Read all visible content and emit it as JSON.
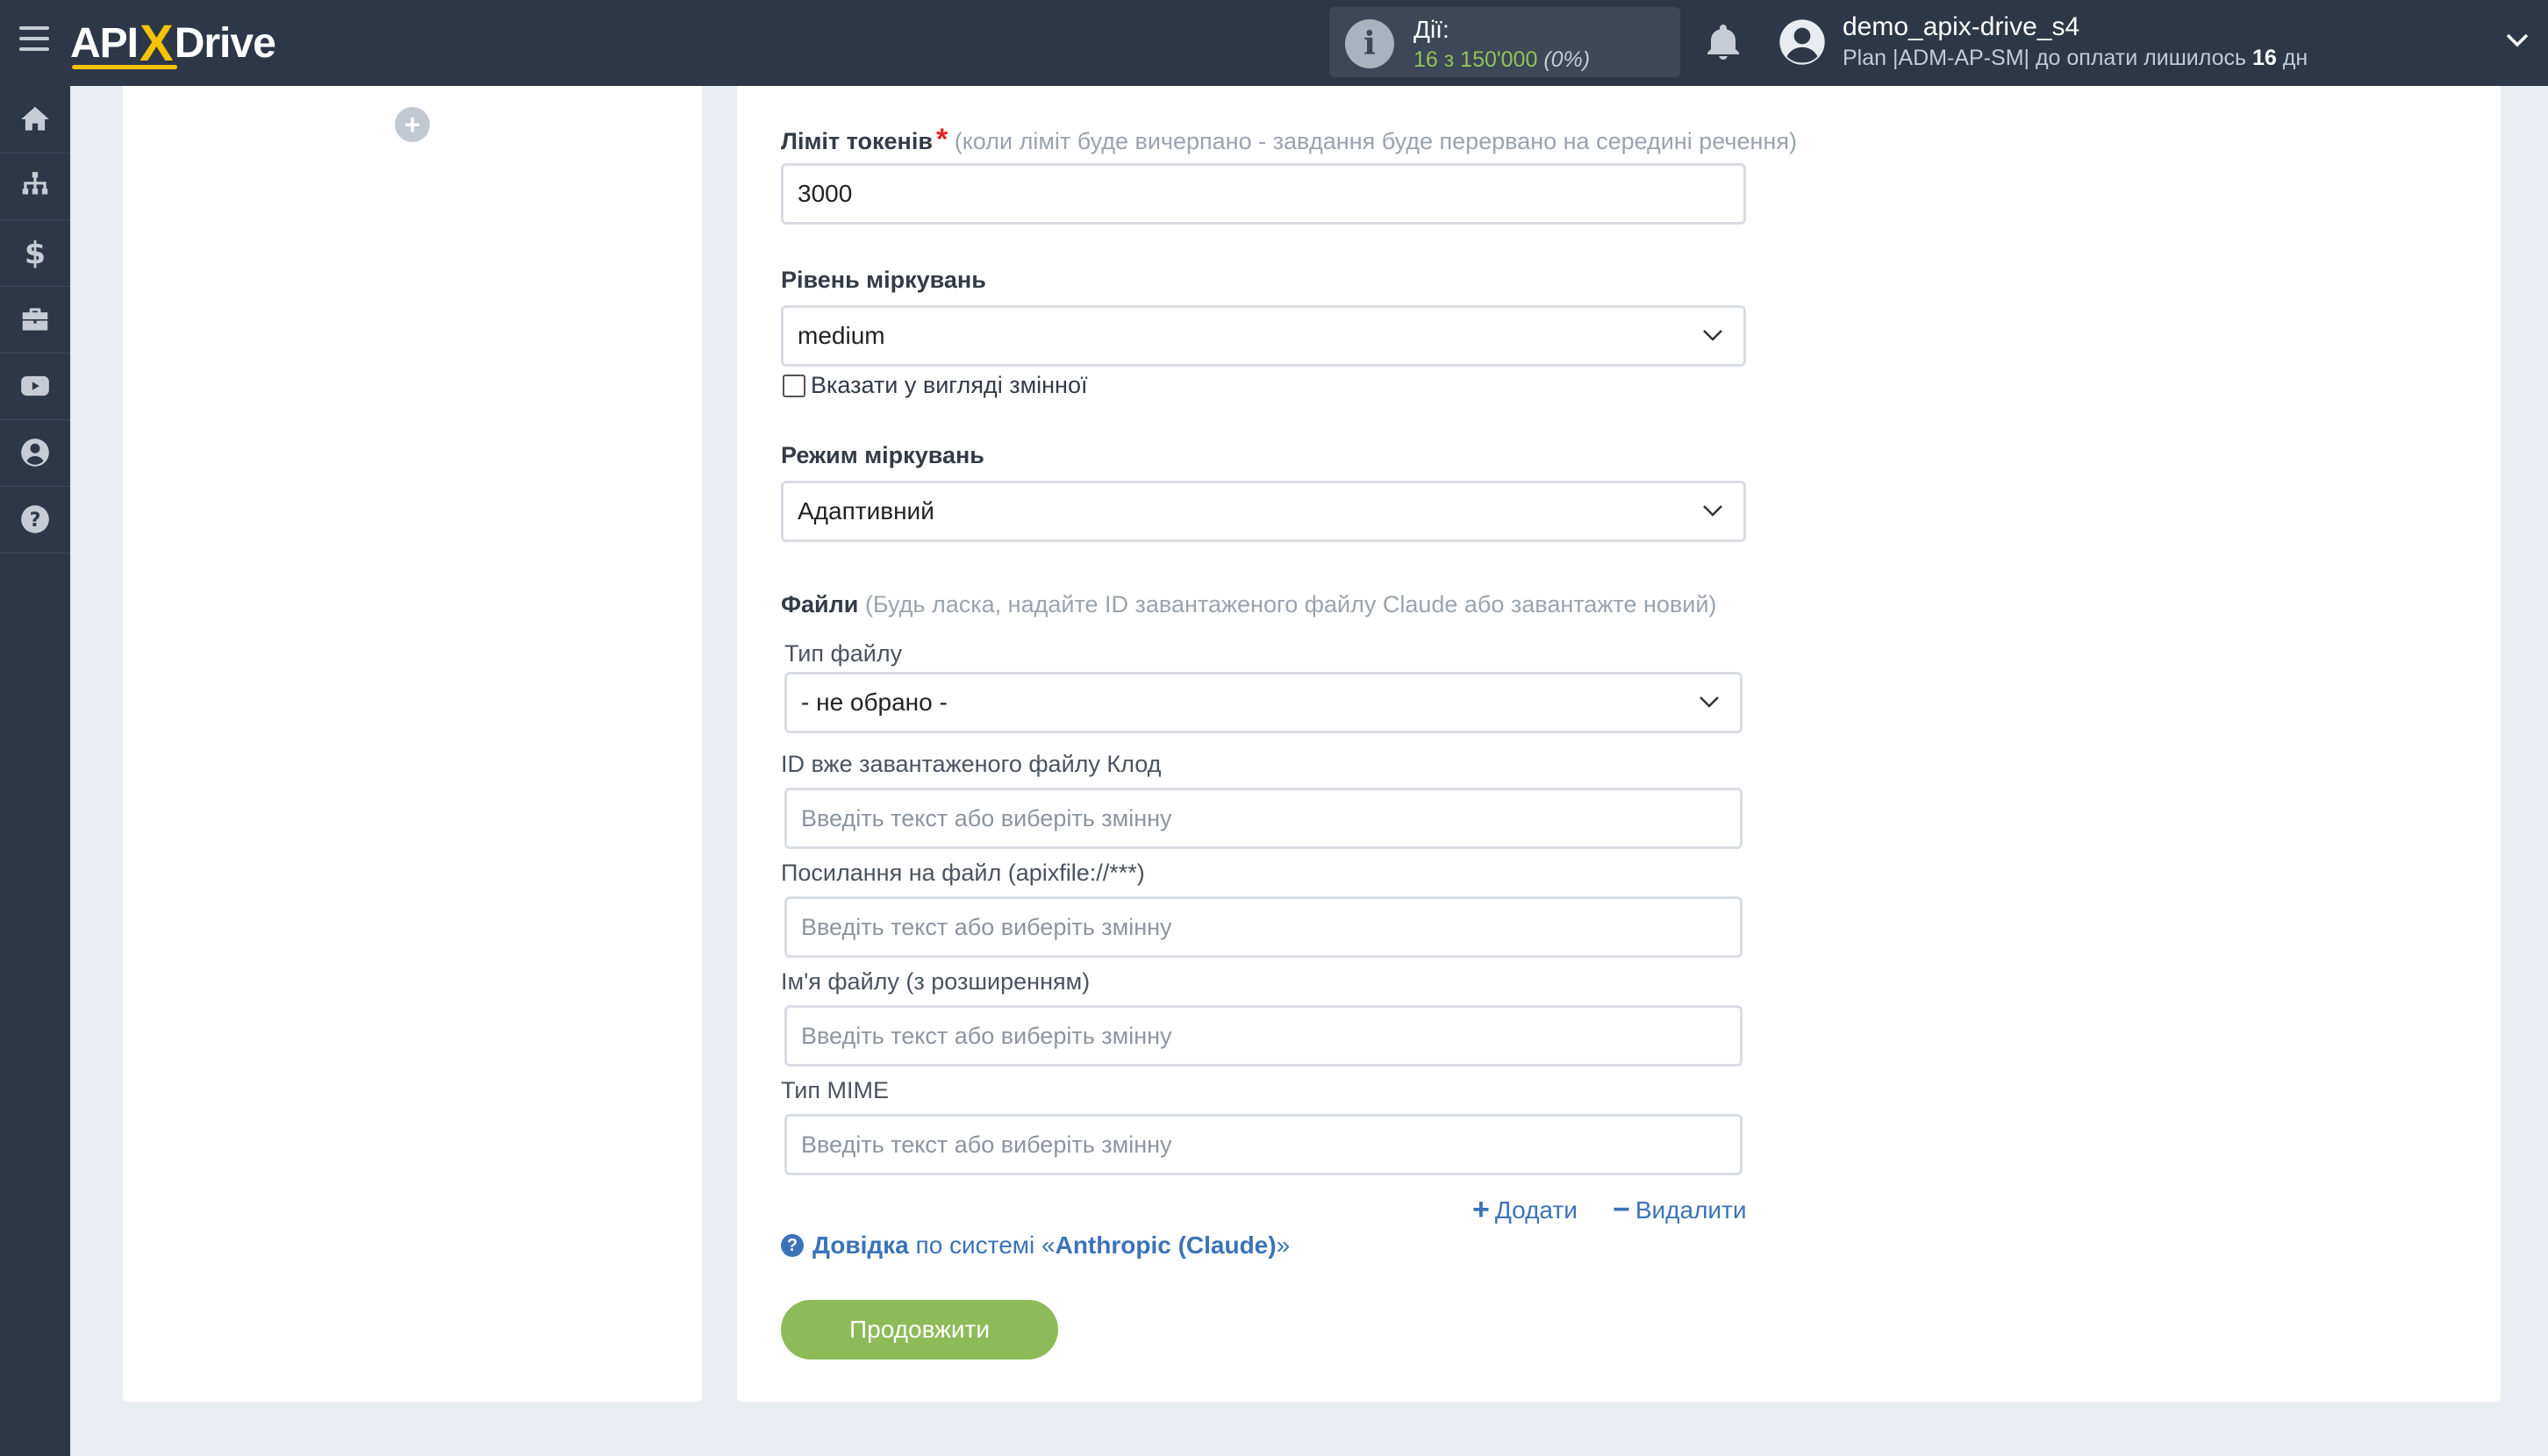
{
  "header": {
    "logo_left": "API",
    "logo_x": "X",
    "logo_right": "Drive",
    "actions_label": "Дії:",
    "actions_count": "16 з 150'000",
    "actions_percent": "(0%)",
    "username": "demo_apix-drive_s4",
    "plan_text": "Plan |ADM-AP-SM| до оплати лишилось",
    "plan_days": "16",
    "plan_suffix": "дн"
  },
  "sidebar": {
    "items": [
      "home-icon",
      "sitemap-icon",
      "dollar-icon",
      "briefcase-icon",
      "youtube-icon",
      "user-icon",
      "help-icon"
    ]
  },
  "form": {
    "token_limit": {
      "label": "Ліміт токенів",
      "required_mark": "*",
      "hint": "(коли ліміт буде вичерпано - завдання буде перервано на середині речення)",
      "value": "3000"
    },
    "reasoning_level": {
      "label": "Рівень міркувань",
      "value": "medium",
      "checkbox_label": "Вказати у вигляді змінної"
    },
    "reasoning_mode": {
      "label": "Режим міркувань",
      "value": "Адаптивний"
    },
    "files": {
      "label": "Файли",
      "hint": "(Будь ласка, надайте ID завантаженого файлу Claude або завантажте новий)",
      "file_type": {
        "label": "Тип файлу",
        "value": "- не обрано -"
      },
      "file_id": {
        "label": "ID вже завантаженого файлу Клод",
        "placeholder": "Введіть текст або виберіть змінну"
      },
      "file_link": {
        "label": "Посилання на файл (apixfile://***)",
        "placeholder": "Введіть текст або виберіть змінну"
      },
      "file_name": {
        "label": "Ім'я файлу (з розширенням)",
        "placeholder": "Введіть текст або виберіть змінну"
      },
      "mime_type": {
        "label": "Тип MIME",
        "placeholder": "Введіть текст або виберіть змінну"
      },
      "add_label": "Додати",
      "remove_label": "Видалити"
    },
    "help": {
      "link_label": "Довідка",
      "middle": "по системі «",
      "system": "Anthropic (Claude)",
      "end": "»"
    },
    "continue_label": "Продовжити"
  },
  "colors": {
    "topbar": "#2d3747",
    "accent_green": "#8dbb5a",
    "link_blue": "#3b73b9",
    "logo_yellow": "#f5c400"
  }
}
